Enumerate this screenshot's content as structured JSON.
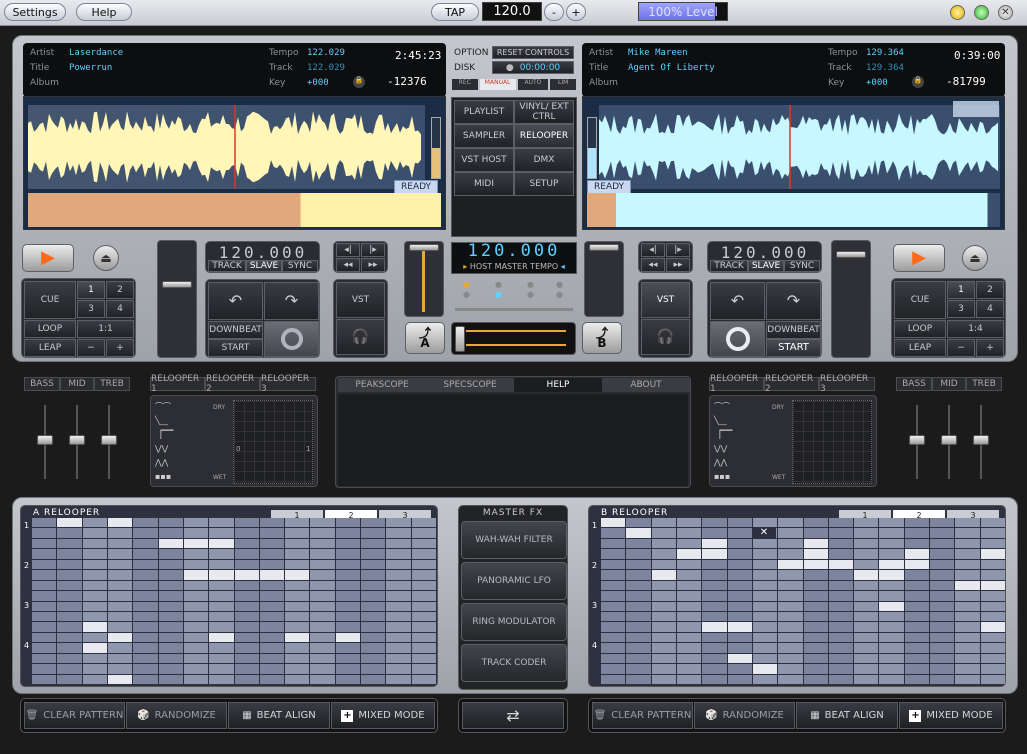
{
  "topbar": {
    "settings": "Settings",
    "help": "Help",
    "tap": "TAP",
    "bpm": "120.0",
    "minus": "-",
    "plus": "+",
    "level": "100% Level"
  },
  "deckA": {
    "artist_label": "Artist",
    "artist": "Laserdance",
    "title_label": "Title",
    "title": "Powerrun",
    "album_label": "Album",
    "tempo_label": "Tempo",
    "tempo": "122.029",
    "track_label": "Track",
    "track": "122.029",
    "key_label": "Key",
    "key": "+000",
    "time": "2:45:23",
    "remain": "-12376",
    "ready": "READY",
    "pitch": "120.000",
    "track_btn": "TRACK",
    "slave_btn": "SLAVE",
    "sync_btn": "SYNC",
    "cue": "CUE",
    "loop": "LOOP",
    "leap": "LEAP",
    "n1": "1",
    "n2": "2",
    "n3": "3",
    "n4": "4",
    "ratio": "1:1",
    "minus": "−",
    "plus": "+",
    "downbeat": "DOWNBEAT",
    "start": "START",
    "vst": "VST",
    "xf": "A"
  },
  "deckB": {
    "artist_label": "Artist",
    "artist": "Mike Mareen",
    "title_label": "Title",
    "title": "Agent Of Liberty",
    "album_label": "Album",
    "tempo_label": "Tempo",
    "tempo": "129.364",
    "track_label": "Track",
    "track": "129.364",
    "key_label": "Key",
    "key": "+000",
    "time": "0:39:00",
    "remain": "-81799",
    "ready": "READY",
    "pitch": "120.000",
    "track_btn": "TRACK",
    "slave_btn": "SLAVE",
    "sync_btn": "SYNC",
    "cue": "CUE",
    "loop": "LOOP",
    "leap": "LEAP",
    "n1": "1",
    "n2": "2",
    "n3": "3",
    "n4": "4",
    "ratio": "1:4",
    "minus": "−",
    "plus": "+",
    "downbeat": "DOWNBEAT",
    "start": "START",
    "vst": "VST",
    "xf": "B"
  },
  "center": {
    "option": "OPTION",
    "disk": "DISK",
    "reset": "RESET CONTROLS",
    "disk_time": "00:00:00",
    "rec": "REC",
    "manual": "MANUAL",
    "auto": "AUTO",
    "lim": "LIM",
    "modes": [
      "PLAYLIST",
      "VINYL/ EXT CTRL",
      "SAMPLER",
      "RELOOPER",
      "VST HOST",
      "DMX",
      "MIDI",
      "SETUP"
    ],
    "master_tempo": "120.000",
    "master_label": "HOST MASTER TEMPO"
  },
  "eqA": [
    "BASS",
    "MID",
    "TREB"
  ],
  "eqB": [
    "BASS",
    "MID",
    "TREB"
  ],
  "relA": [
    "RELOOPER 1",
    "RELOOPER 2",
    "RELOOPER 3"
  ],
  "relB": [
    "RELOOPER 1",
    "RELOOPER 2",
    "RELOOPER 3"
  ],
  "xy": {
    "dry": "DRY",
    "wet": "WET",
    "zero": "0",
    "one": "1"
  },
  "tabs": [
    "PEAKSCOPE",
    "SPECSCOPE",
    "HELP",
    "ABOUT"
  ],
  "gridA": {
    "title": "A  RELOOPER",
    "pages": [
      "1",
      "2",
      "3"
    ],
    "rows": [
      "1",
      "2",
      "3",
      "4"
    ]
  },
  "gridB": {
    "title": "B  RELOOPER",
    "pages": [
      "1",
      "2",
      "3"
    ],
    "rows": [
      "1",
      "2",
      "3",
      "4"
    ],
    "mark": "✕"
  },
  "masterfx": {
    "title": "MASTER FX",
    "items": [
      "WAH-WAH FILTER",
      "PANORAMIC LFO",
      "RING MODULATOR",
      "TRACK CODER"
    ]
  },
  "bottomA": {
    "clear": "CLEAR PATTERN",
    "randomize": "RANDOMIZE",
    "beat": "BEAT ALIGN",
    "mixed": "MIXED MODE"
  },
  "bottomB": {
    "clear": "CLEAR PATTERN",
    "randomize": "RANDOMIZE",
    "beat": "BEAT ALIGN",
    "mixed": "MIXED MODE"
  },
  "colors": {
    "waveA": "#fff6b8",
    "waveB": "#c7f7ff",
    "accent": "#5fd0ff",
    "play": "#ff7a2a"
  }
}
